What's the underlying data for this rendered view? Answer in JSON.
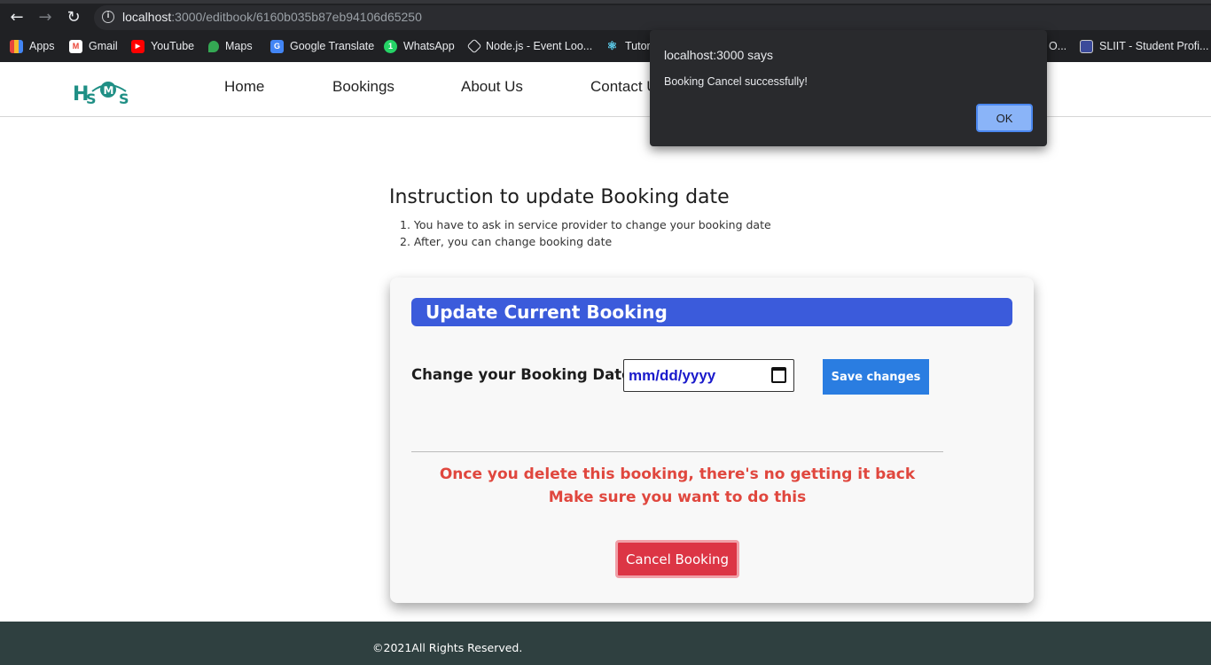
{
  "browser": {
    "url_host": "localhost",
    "url_rest": ":3000/editbook/6160b035b87eb94106d65250",
    "back_icon": "back-arrow-icon",
    "forward_icon": "forward-arrow-icon",
    "reload_icon": "reload-icon"
  },
  "bookmarks": [
    {
      "label": "Apps",
      "icon": "apps-grid-icon",
      "color": "#e8453c"
    },
    {
      "label": "Gmail",
      "icon": "gmail-icon",
      "color": "#ea4335"
    },
    {
      "label": "YouTube",
      "icon": "youtube-icon",
      "color": "#ff0000"
    },
    {
      "label": "Maps",
      "icon": "maps-pin-icon",
      "color": "#34a853"
    },
    {
      "label": "Google Translate",
      "icon": "translate-icon",
      "color": "#4285f4"
    },
    {
      "label": "WhatsApp",
      "icon": "whatsapp-icon",
      "color": "#25d366"
    },
    {
      "label": "Node.js - Event Loo...",
      "icon": "nodejs-icon",
      "color": "#ffffff"
    },
    {
      "label": "Tutor",
      "icon": "react-icon",
      "color": "#61dafb"
    },
    {
      "label": "O...",
      "icon": "",
      "color": ""
    },
    {
      "label": "SLIIT - Student Profi...",
      "icon": "sliit-icon",
      "color": "#3b4a9a"
    }
  ],
  "nav": {
    "logo_text": "HSMS",
    "home": "Home",
    "bookings": "Bookings",
    "about": "About Us",
    "contact": "Contact U"
  },
  "instructions": {
    "title": "Instruction to update Booking date",
    "items": [
      "1. You have to ask in service provider to change your booking date",
      "2. After, you can change booking date"
    ]
  },
  "card": {
    "title": "Update Current Booking",
    "date_label": "Change your Booking Date",
    "date_value": "mm/dd/yyyy",
    "save_label": "Save changes",
    "warning_line1": "Once you delete this booking, there's no getting it back",
    "warning_line2": "Make sure you want to do this",
    "cancel_label": "Cancel Booking"
  },
  "footer": {
    "text": "©2021All Rights Reserved."
  },
  "dialog": {
    "title": "localhost:3000 says",
    "message": "Booking Cancel successfully!",
    "ok_label": "OK"
  },
  "colors": {
    "title_bar": "#3b5bdb",
    "save_button": "#2a7de1",
    "cancel_button": "#dc3545",
    "warning_text": "#e0473e",
    "footer_bg": "#2f4040"
  }
}
